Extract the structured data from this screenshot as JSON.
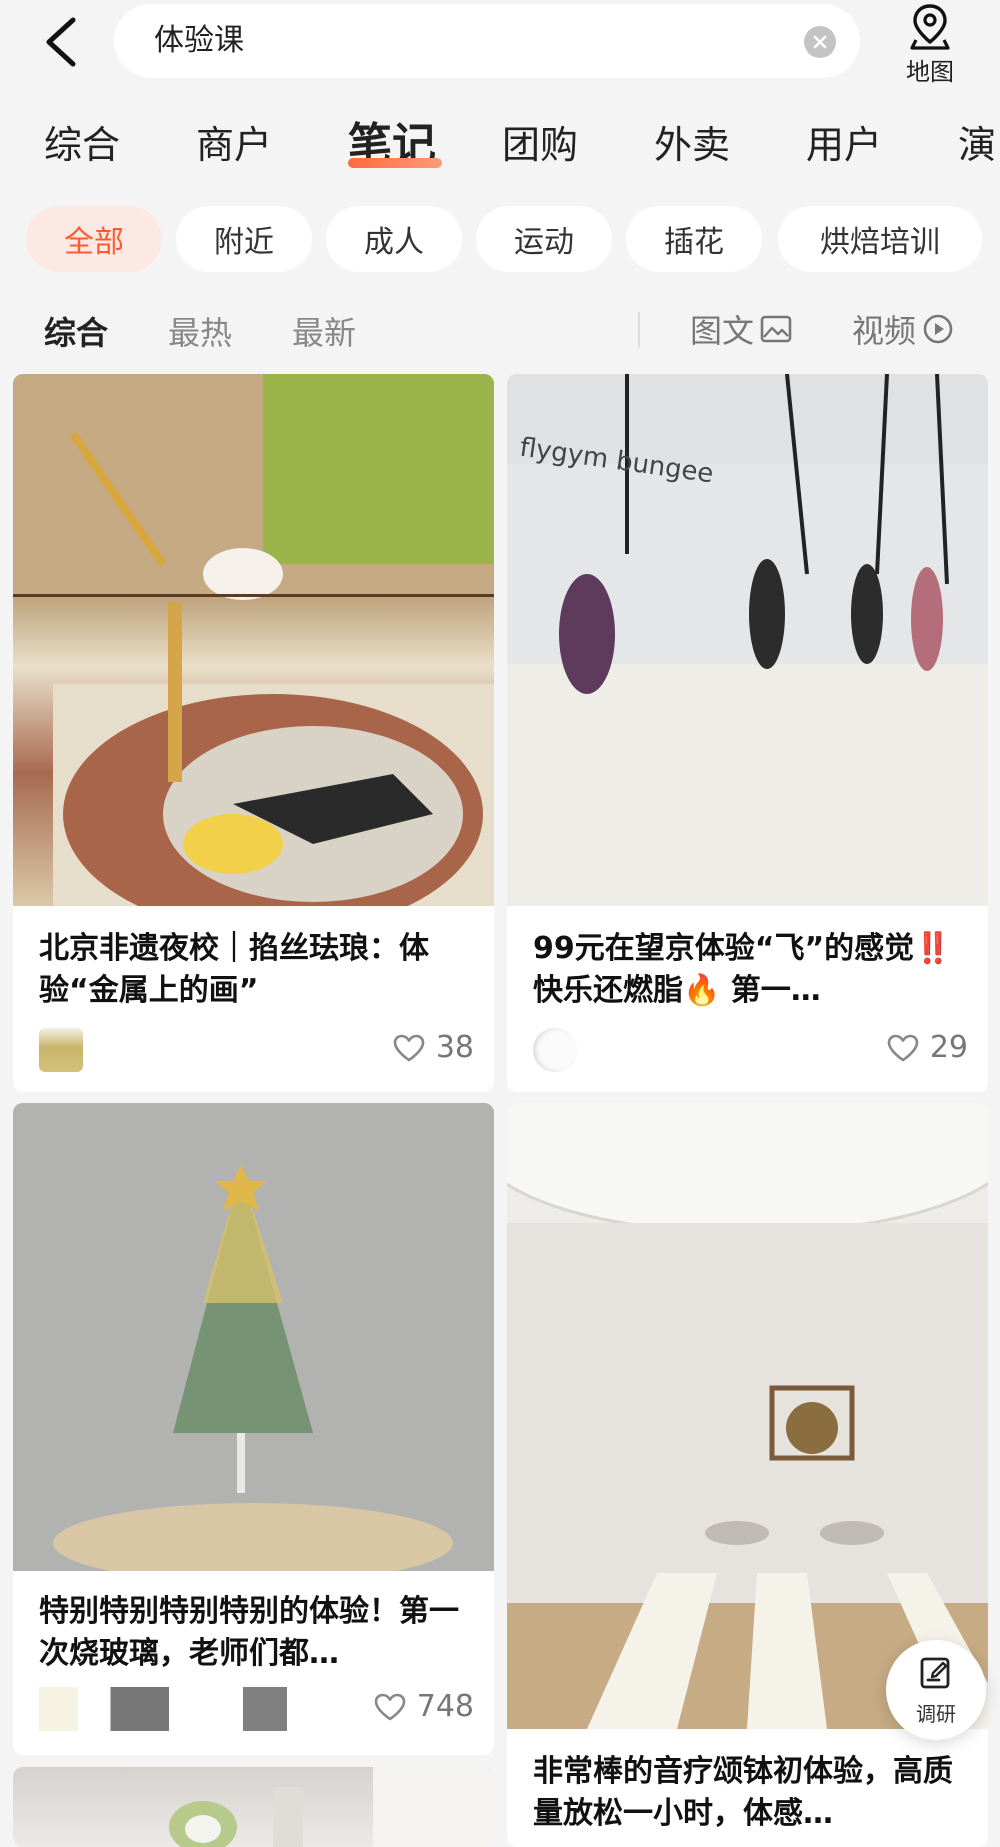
{
  "search": {
    "query": "体验课",
    "map_label": "地图"
  },
  "main_tabs": [
    {
      "label": "综合"
    },
    {
      "label": "商户"
    },
    {
      "label": "笔记",
      "active": true
    },
    {
      "label": "团购"
    },
    {
      "label": "外卖"
    },
    {
      "label": "用户"
    },
    {
      "label": "演"
    }
  ],
  "chips": [
    {
      "label": "全部",
      "active": true
    },
    {
      "label": "附近"
    },
    {
      "label": "成人"
    },
    {
      "label": "运动"
    },
    {
      "label": "插花"
    },
    {
      "label": "烘焙培训"
    }
  ],
  "sort": {
    "options": [
      {
        "label": "综合",
        "active": true
      },
      {
        "label": "最热"
      },
      {
        "label": "最新"
      }
    ],
    "view_text_label": "图文",
    "view_video_label": "视频"
  },
  "cards": [
    {
      "title": "北京非遗夜校｜掐丝珐琅：体验“金属上的画”",
      "likes": "38",
      "image": "enamel-painting-photo"
    },
    {
      "title": "99元在望京体验“飞”的感觉‼️快乐还燃脂🔥 第一…",
      "likes": "29",
      "image": "bungee-fitness-photo",
      "image_text": "flygym bungee"
    },
    {
      "title": "特别特别特别特别的体验！第一次烧玻璃，老师们都…",
      "likes": "748",
      "image": "glass-christmas-tree-photo"
    },
    {
      "title": "非常棒的音疗颂钵初体验，高质量放松一小时，体感…",
      "image": "sound-bath-room-photo"
    },
    {
      "image": "table-setting-photo"
    }
  ],
  "survey_label": "调研",
  "colors": {
    "accent": "#ff5a2e",
    "chip_active_bg": "#fde9e3",
    "background": "#f4f4f5"
  }
}
